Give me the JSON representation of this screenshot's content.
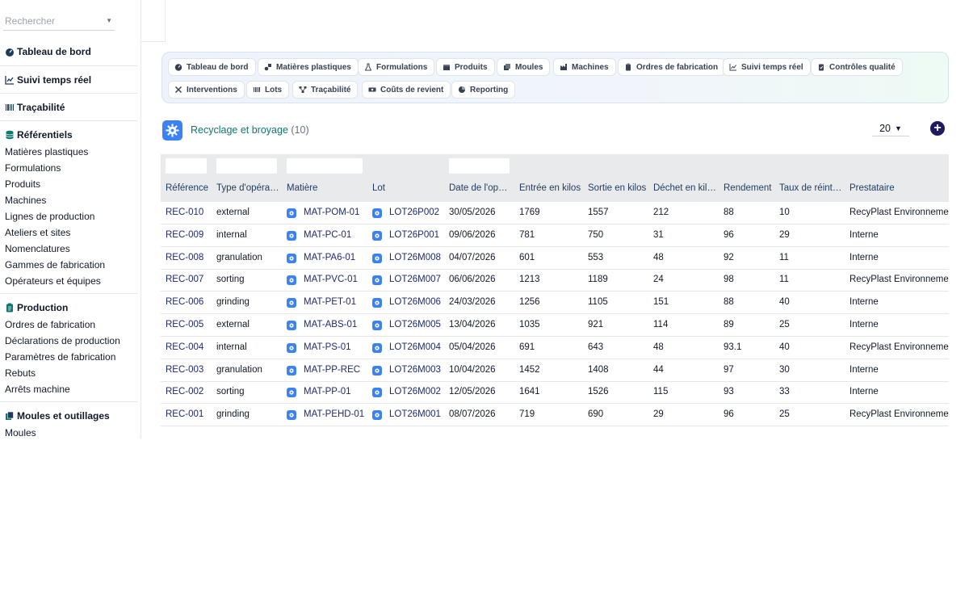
{
  "sidebar": {
    "search_placeholder": "Rechercher",
    "sections": {
      "dashboard": "Tableau de bord",
      "realtime": "Suivi temps réel",
      "traceability": "Traçabilité",
      "referentials": "Référentiels",
      "production": "Production",
      "molds": "Moules et outillages"
    },
    "referential_items": [
      "Matières plastiques",
      "Formulations",
      "Produits",
      "Machines",
      "Lignes de production",
      "Ateliers et sites",
      "Nomenclatures",
      "Gammes de fabrication",
      "Opérateurs et équipes"
    ],
    "production_items": [
      "Ordres de fabrication",
      "Déclarations de production",
      "Paramètres de fabrication",
      "Rebuts",
      "Arrêts machine"
    ],
    "mold_items": [
      "Moules"
    ]
  },
  "nav": {
    "pills": [
      "Tableau de bord",
      "Matières plastiques",
      "Formulations",
      "Produits",
      "Moules",
      "Machines",
      "Ordres de fabrication",
      "Suivi temps réel",
      "Contrôles qualité",
      "Interventions",
      "Lots",
      "Traçabilité",
      "Coûts de revient",
      "Reporting"
    ]
  },
  "header": {
    "title": "Recyclage et broyage",
    "count": "(10)",
    "page_size": "20"
  },
  "table": {
    "columns": [
      "Référence",
      "Type d'opéra…",
      "Matière",
      "Lot",
      "Date de l'op…",
      "Entrée en kilos",
      "Sortie en kilos",
      "Déchet en kil…",
      "Rendement",
      "Taux de réint…",
      "Prestataire"
    ],
    "rows": [
      [
        "REC-010",
        "external",
        "MAT-POM-01",
        "LOT26P002",
        "30/05/2026",
        "1769",
        "1557",
        "212",
        "88",
        "10",
        "RecyPlast Environnement"
      ],
      [
        "REC-009",
        "internal",
        "MAT-PC-01",
        "LOT26P001",
        "09/06/2026",
        "781",
        "750",
        "31",
        "96",
        "29",
        "Interne"
      ],
      [
        "REC-008",
        "granulation",
        "MAT-PA6-01",
        "LOT26M008",
        "04/07/2026",
        "601",
        "553",
        "48",
        "92",
        "11",
        "Interne"
      ],
      [
        "REC-007",
        "sorting",
        "MAT-PVC-01",
        "LOT26M007",
        "06/06/2026",
        "1213",
        "1189",
        "24",
        "98",
        "11",
        "RecyPlast Environnement"
      ],
      [
        "REC-006",
        "grinding",
        "MAT-PET-01",
        "LOT26M006",
        "24/03/2026",
        "1256",
        "1105",
        "151",
        "88",
        "40",
        "Interne"
      ],
      [
        "REC-005",
        "external",
        "MAT-ABS-01",
        "LOT26M005",
        "13/04/2026",
        "1035",
        "921",
        "114",
        "89",
        "25",
        "Interne"
      ],
      [
        "REC-004",
        "internal",
        "MAT-PS-01",
        "LOT26M004",
        "05/04/2026",
        "691",
        "643",
        "48",
        "93.1",
        "40",
        "RecyPlast Environnement"
      ],
      [
        "REC-003",
        "granulation",
        "MAT-PP-REC",
        "LOT26M003",
        "10/04/2026",
        "1452",
        "1408",
        "44",
        "97",
        "30",
        "Interne"
      ],
      [
        "REC-002",
        "sorting",
        "MAT-PP-01",
        "LOT26M002",
        "12/05/2026",
        "1641",
        "1526",
        "115",
        "93",
        "33",
        "Interne"
      ],
      [
        "REC-001",
        "grinding",
        "MAT-PEHD-01",
        "LOT26M001",
        "08/07/2026",
        "719",
        "690",
        "29",
        "96",
        "25",
        "RecyPlast Environnement"
      ]
    ]
  },
  "colors": {
    "accent": "#3b82f6",
    "title_teal": "#0f766e",
    "link_navy": "#1e2a6e",
    "add_button": "#1e1b5e"
  }
}
